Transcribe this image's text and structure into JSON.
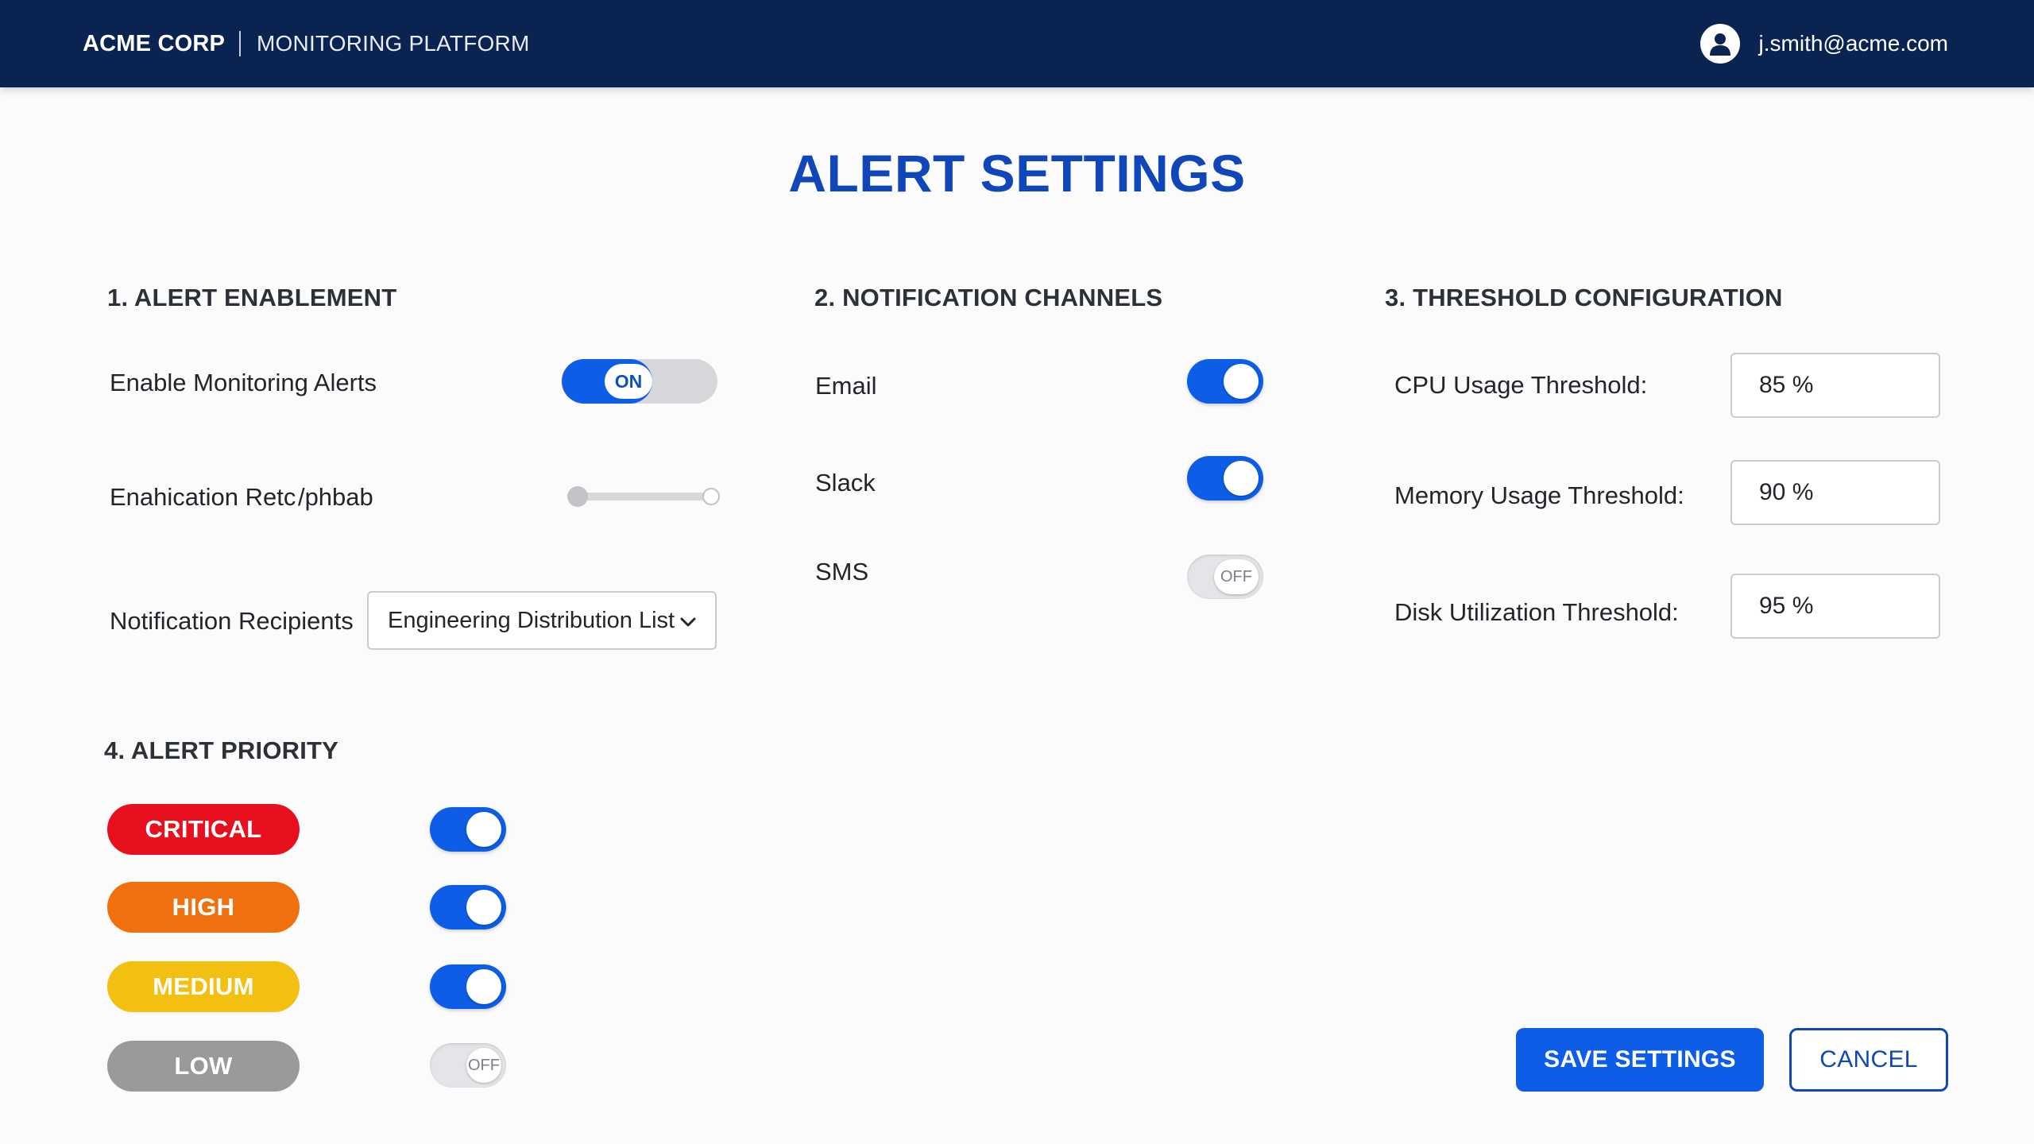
{
  "header": {
    "brand": "ACME CORP",
    "product": "MONITORING PLATFORM",
    "user_icon": "user-avatar-icon",
    "user_email": "j.smith@acme.com"
  },
  "page": {
    "title": "ALERT SETTINGS"
  },
  "enablement": {
    "title": "1. ALERT ENABLEMENT",
    "enable_label": "Enable Monitoring Alerts",
    "enable_state": "ON",
    "slider_label": "Enahication Retc /phbab",
    "slider_value": 0,
    "recipients_label": "Notification Recipients",
    "recipients_value": "Engineering Distribution List"
  },
  "channels": {
    "title": "2. NOTIFICATION CHANNELS",
    "items": [
      {
        "label": "Email",
        "state": "on"
      },
      {
        "label": "Slack",
        "state": "on"
      },
      {
        "label": "SMS",
        "state": "OFF"
      }
    ]
  },
  "thresholds": {
    "title": "3. THRESHOLD CONFIGURATION",
    "items": [
      {
        "label": "CPU Usage Threshold:",
        "value": "85 %"
      },
      {
        "label": "Memory Usage Threshold:",
        "value": "90 %"
      },
      {
        "label": "Disk Utilization Threshold:",
        "value": "95 %"
      }
    ]
  },
  "priority": {
    "title": "4. ALERT PRIORITY",
    "items": [
      {
        "label": "CRITICAL",
        "color": "#e8101f",
        "state": "on"
      },
      {
        "label": "HIGH",
        "color": "#f0700f",
        "state": "on"
      },
      {
        "label": "MEDIUM",
        "color": "#f3bf10",
        "state": "on"
      },
      {
        "label": "LOW",
        "color": "#999a9c",
        "state": "OFF"
      }
    ]
  },
  "actions": {
    "save_label": "SAVE SETTINGS",
    "cancel_label": "CANCEL"
  },
  "colors": {
    "header_bg": "#0b2350",
    "accent": "#0d5de6",
    "title": "#1047b8"
  }
}
